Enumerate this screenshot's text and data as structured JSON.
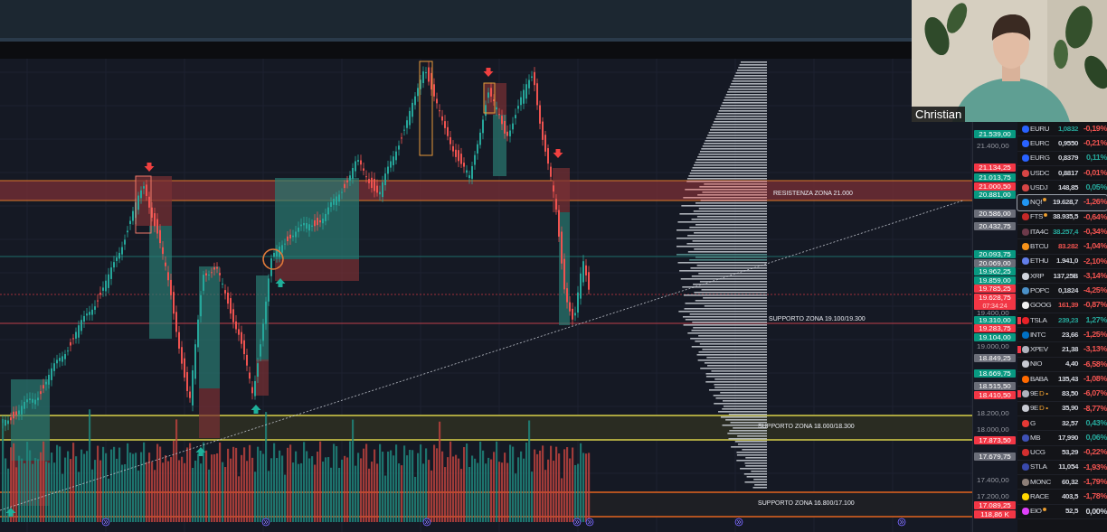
{
  "webcam": {
    "name": "Christian"
  },
  "chart": {
    "zone_labels": [
      "RESISTENZA ZONA 21.000",
      "SUPPORTO ZONA 19.100/19.300",
      "SUPPORTO ZONA 18.000/18.300",
      "SUPPORTO ZONA 16.800/17.100"
    ]
  },
  "price_axis": {
    "ticks": [
      "21.400,00",
      "19.400,00",
      "19.000,00",
      "18.200,00",
      "18.000,00",
      "17.400,00",
      "17.200,00"
    ],
    "tags": [
      {
        "value": "21.539,00",
        "color": "#089981"
      },
      {
        "value": "21.134,25",
        "color": "#f23645"
      },
      {
        "value": "21.013,75",
        "color": "#089981"
      },
      {
        "value": "21.000,50",
        "color": "#f23645"
      },
      {
        "value": "20.881,00",
        "color": "#089981"
      },
      {
        "value": "20.586,00",
        "color": "#6a6d78"
      },
      {
        "value": "20.432,75",
        "color": "#6a6d78"
      },
      {
        "value": "20.093,75",
        "color": "#089981"
      },
      {
        "value": "20.069,00",
        "color": "#6a6d78"
      },
      {
        "value": "19.962,25",
        "color": "#089981"
      },
      {
        "value": "19.859,00",
        "color": "#089981"
      },
      {
        "value": "19.785,25",
        "color": "#f23645"
      },
      {
        "value": "19.628,75",
        "color": "#f23645",
        "countdown": "07:34:24"
      },
      {
        "value": "19.310,00",
        "color": "#089981"
      },
      {
        "value": "19.283,75",
        "color": "#f23645"
      },
      {
        "value": "19.104,00",
        "color": "#089981"
      },
      {
        "value": "18.849,25",
        "color": "#6a6d78"
      },
      {
        "value": "18.669,75",
        "color": "#089981"
      },
      {
        "value": "18.515,50",
        "color": "#6a6d78"
      },
      {
        "value": "18.410,50",
        "color": "#f23645"
      },
      {
        "value": "17.873,50",
        "color": "#f23645"
      },
      {
        "value": "17.679,75",
        "color": "#6a6d78"
      },
      {
        "value": "17.089,25",
        "color": "#f23645"
      },
      {
        "value": "118,86 K",
        "color": "#f23645",
        "kind": "volume"
      }
    ]
  },
  "watchlist": [
    {
      "symbol": "EURU",
      "price": {
        "text": "1,0832",
        "color": "#26a69a"
      },
      "change": {
        "text": "-0,19%",
        "color": "#ef5350"
      },
      "color": "#2962ff",
      "flagged": false,
      "selected": false,
      "status_dot": false
    },
    {
      "symbol": "EURC",
      "price": {
        "text": "0,9550",
        "color": "#d1d4dc"
      },
      "change": {
        "text": "-0,21%",
        "color": "#ef5350"
      },
      "color": "#2962ff",
      "flagged": false,
      "selected": false,
      "status_dot": false
    },
    {
      "symbol": "EURG",
      "price": {
        "text": "0,8379",
        "color": "#d1d4dc"
      },
      "change": {
        "text": "0,11%",
        "color": "#26a69a"
      },
      "color": "#2962ff",
      "flagged": false,
      "selected": false,
      "status_dot": false
    },
    {
      "symbol": "USDC",
      "price": {
        "text": "0,8817",
        "color": "#d1d4dc"
      },
      "change": {
        "text": "-0,01%",
        "color": "#ef5350"
      },
      "color": "#d64545",
      "flagged": false,
      "selected": false,
      "status_dot": false
    },
    {
      "symbol": "USDJ",
      "price": {
        "text": "148,85",
        "color": "#d1d4dc"
      },
      "change": {
        "text": "0,05%",
        "color": "#26a69a"
      },
      "color": "#d64545",
      "flagged": false,
      "selected": false,
      "status_dot": false
    },
    {
      "symbol": "NQ!",
      "price": {
        "text": "19.628,7",
        "color": "#d1d4dc"
      },
      "change": {
        "text": "-1,26%",
        "color": "#ef5350"
      },
      "color": "#2196f3",
      "flagged": false,
      "selected": true,
      "status_dot": true
    },
    {
      "symbol": "FTS",
      "price": {
        "text": "38.935,5",
        "color": "#d1d4dc"
      },
      "change": {
        "text": "-0,64%",
        "color": "#ef5350"
      },
      "color": "#c62828",
      "flagged": false,
      "selected": false,
      "status_dot": true
    },
    {
      "symbol": "ITA4C",
      "price": {
        "text": "38.257,4",
        "color": "#26a69a"
      },
      "change": {
        "text": "-0,34%",
        "color": "#ef5350"
      },
      "color": "#6d3a4a",
      "flagged": false,
      "selected": false,
      "status_dot": false
    },
    {
      "symbol": "BTCU",
      "price": {
        "text": "83.282",
        "color": "#ef5350"
      },
      "change": {
        "text": "-1,04%",
        "color": "#ef5350"
      },
      "color": "#f7931a",
      "flagged": false,
      "selected": false,
      "status_dot": false
    },
    {
      "symbol": "ETHU",
      "price": {
        "text": "1.941,0",
        "color": "#d1d4dc"
      },
      "change": {
        "text": "-2,10%",
        "color": "#ef5350"
      },
      "color": "#627eea",
      "flagged": false,
      "selected": false,
      "status_dot": false
    },
    {
      "symbol": "XRP",
      "price": {
        "text": "137,25B",
        "color": "#d1d4dc"
      },
      "change": {
        "text": "-3,14%",
        "color": "#ef5350"
      },
      "color": "#d1d4dc",
      "flagged": false,
      "selected": false,
      "status_dot": false
    },
    {
      "symbol": "POPC",
      "price": {
        "text": "0,1824",
        "color": "#d1d4dc"
      },
      "change": {
        "text": "-4,25%",
        "color": "#ef5350"
      },
      "color": "#4a90c8",
      "flagged": false,
      "selected": false,
      "status_dot": false
    },
    {
      "symbol": "GOOG",
      "price": {
        "text": "161,39",
        "color": "#ef5350"
      },
      "change": {
        "text": "-0,87%",
        "color": "#ef5350"
      },
      "color": "#f1f1f1",
      "flagged": false,
      "selected": false,
      "status_dot": false
    },
    {
      "symbol": "TSLA",
      "price": {
        "text": "239,23",
        "color": "#26a69a"
      },
      "change": {
        "text": "1,27%",
        "color": "#26a69a"
      },
      "color": "#e82127",
      "flagged": true,
      "selected": false,
      "status_dot": false
    },
    {
      "symbol": "INTC",
      "price": {
        "text": "23,66",
        "color": "#d1d4dc"
      },
      "change": {
        "text": "-1,25%",
        "color": "#ef5350"
      },
      "color": "#0071c5",
      "flagged": false,
      "selected": false,
      "status_dot": false
    },
    {
      "symbol": "XPEV",
      "price": {
        "text": "21,38",
        "color": "#d1d4dc"
      },
      "change": {
        "text": "-3,13%",
        "color": "#ef5350"
      },
      "color": "#b0b3bd",
      "flagged": true,
      "selected": false,
      "status_dot": false
    },
    {
      "symbol": "NIO",
      "price": {
        "text": "4,40",
        "color": "#d1d4dc"
      },
      "change": {
        "text": "-6,58%",
        "color": "#ef5350"
      },
      "color": "#c8cad2",
      "flagged": false,
      "selected": false,
      "status_dot": false
    },
    {
      "symbol": "BABA",
      "price": {
        "text": "135,43",
        "color": "#d1d4dc"
      },
      "change": {
        "text": "-1,08%",
        "color": "#ef5350"
      },
      "color": "#ff6a00",
      "flagged": false,
      "selected": false,
      "status_dot": false
    },
    {
      "symbol": "9E",
      "suffix": "D •",
      "price": {
        "text": "83,50",
        "color": "#d1d4dc"
      },
      "change": {
        "text": "-6,07%",
        "color": "#ef5350"
      },
      "color": "#b0b3bd",
      "flagged": true,
      "selected": false,
      "status_dot": false
    },
    {
      "symbol": "9E",
      "suffix": "D •",
      "price": {
        "text": "35,90",
        "color": "#d1d4dc"
      },
      "change": {
        "text": "-8,77%",
        "color": "#ef5350"
      },
      "color": "#c8cad2",
      "flagged": false,
      "selected": false,
      "status_dot": false
    },
    {
      "symbol": "G",
      "price": {
        "text": "32,57",
        "color": "#d1d4dc"
      },
      "change": {
        "text": "0,43%",
        "color": "#26a69a"
      },
      "color": "#e53935",
      "flagged": false,
      "selected": false,
      "status_dot": false
    },
    {
      "symbol": "MB",
      "price": {
        "text": "17,990",
        "color": "#d1d4dc"
      },
      "change": {
        "text": "0,06%",
        "color": "#26a69a"
      },
      "color": "#3f51b5",
      "flagged": false,
      "selected": false,
      "status_dot": false
    },
    {
      "symbol": "UCG",
      "price": {
        "text": "53,29",
        "color": "#d1d4dc"
      },
      "change": {
        "text": "-0,22%",
        "color": "#ef5350"
      },
      "color": "#d32f2f",
      "flagged": false,
      "selected": false,
      "status_dot": false
    },
    {
      "symbol": "STLA",
      "price": {
        "text": "11,054",
        "color": "#d1d4dc"
      },
      "change": {
        "text": "-1,93%",
        "color": "#ef5350"
      },
      "color": "#3949ab",
      "flagged": false,
      "selected": false,
      "status_dot": false
    },
    {
      "symbol": "MONC",
      "price": {
        "text": "60,32",
        "color": "#d1d4dc"
      },
      "change": {
        "text": "-1,79%",
        "color": "#ef5350"
      },
      "color": "#8d7f78",
      "flagged": false,
      "selected": false,
      "status_dot": false
    },
    {
      "symbol": "RACE",
      "price": {
        "text": "403,5",
        "color": "#d1d4dc"
      },
      "change": {
        "text": "-1,78%",
        "color": "#ef5350"
      },
      "color": "#ffd600",
      "flagged": false,
      "selected": false,
      "status_dot": false
    },
    {
      "symbol": "EIO",
      "price": {
        "text": "52,5",
        "color": "#d1d4dc"
      },
      "change": {
        "text": "0,00%",
        "color": "#d1d4dc"
      },
      "color": "#e040fb",
      "flagged": false,
      "selected": false,
      "status_dot": true
    }
  ]
}
